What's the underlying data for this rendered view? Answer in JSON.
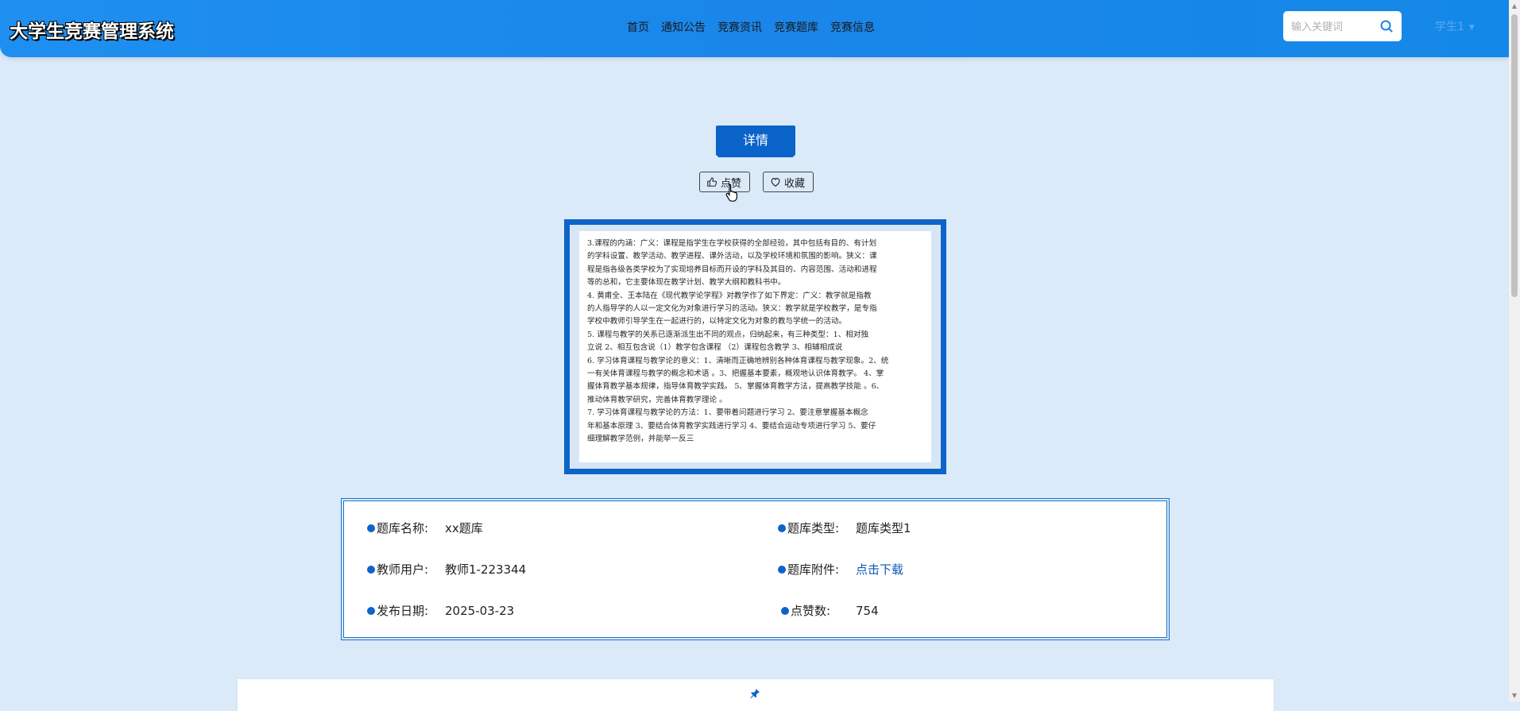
{
  "header": {
    "brand": "大学生竞赛管理系统",
    "nav": [
      "首页",
      "通知公告",
      "竞赛资讯",
      "竞赛题库",
      "竞赛信息"
    ],
    "search_placeholder": "输入关键词",
    "user_label": "学生1",
    "accent": "#1a86ea"
  },
  "page": {
    "detail_title": "详情",
    "like_label": "点赞",
    "favorite_label": "收藏"
  },
  "document_image": {
    "lines": [
      "3.课程的内涵：广义：课程是指学生在学校获得的全部经验，其中包括有目的、有计划",
      "的学科设置、教学活动、教学进程、课外活动，以及学校环境和氛围的影响。狭义：课",
      "程是指各级各类学校为了实现培养目标而开设的学科及其目的、内容范围、活动和进程",
      "等的总和，它主要体现在教学计划、教学大纲和教科书中。",
      "4.    黄甫全、王本陆在《现代教学论学程》对教学作了如下界定：广义：教学就是指教",
      "的人指导学的人以一定文化为对象进行学习的活动。狭义：教学就是学校教学，是专指",
      "学校中教师引导学生在一起进行的，以特定文化为对象的教与学统一的活动。",
      "5.    课程与教学的关系已逐渐派生出不同的观点，归纳起来，有三种类型：1、相对独",
      "立说 2、相互包含说（1）教学包含课程 （2）课程包含教学 3、相辅相成说",
      "6.    学习体育课程与教学论的意义：1、清晰而正确地辨别各种体育课程与教学现象。2、统",
      "一有关体育课程与教学的概念和术语 。3、把握基本要素，概观地认识体育教学。 4、掌",
      "握体育教学基本规律，指导体育教学实践。 5、掌握体育教学方法，提高教学技能 。6、",
      "推动体育教学研究，完善体育教学理论 。",
      "7.    学习体育课程与教学论的方法：1、要带着问题进行学习 2、要注意掌握基本概念",
      "年和基本原理 3、要结合体育教学实践进行学习 4、要结合运动专项进行学习 5、要仔",
      "细理解教学范例，并能举一反三"
    ]
  },
  "info": {
    "bank_name_label": "题库名称:",
    "bank_name_value": "xx题库",
    "bank_type_label": "题库类型:",
    "bank_type_value": "题库类型1",
    "teacher_label": "教师用户:",
    "teacher_value": "教师1-223344",
    "attachment_label": "题库附件:",
    "attachment_value": "点击下载",
    "date_label": "发布日期:",
    "date_value": "2025-03-23",
    "likes_label": "点赞数:",
    "likes_value": "754"
  }
}
